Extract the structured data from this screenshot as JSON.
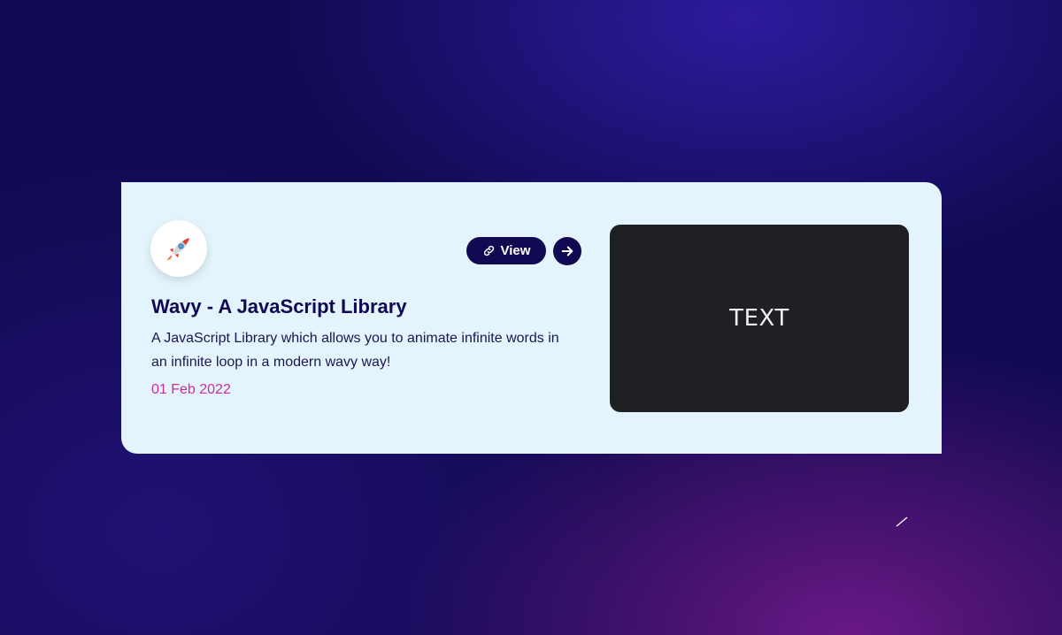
{
  "card": {
    "icon": "rocket-icon",
    "view_label": "View",
    "view_icon": "link-icon",
    "arrow_icon": "arrow-right-icon",
    "title": "Wavy - A JavaScript Library",
    "description": "A JavaScript Library which allows you to animate infinite words in an infinite loop in a modern wavy way!",
    "date": "01 Feb 2022",
    "preview_text": "TEXT"
  },
  "colors": {
    "background_dark": "#110a52",
    "card_bg": "#e3f4fc",
    "accent_navy": "#110a52",
    "date_pink": "#d02aa0",
    "preview_bg": "#1f2024"
  }
}
